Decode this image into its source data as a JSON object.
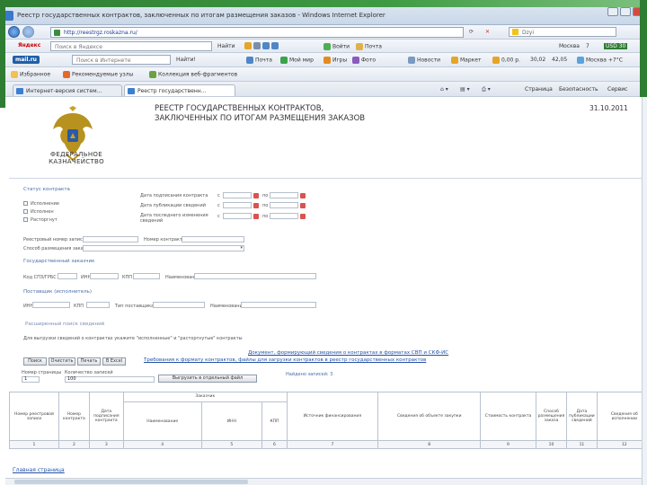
{
  "window": {
    "title": "Реестр государственных контрактов, заключенных по итогам размещения заказов - Windows Internet Explorer"
  },
  "toolbar1": {
    "url": "http://reestrgz.roskazna.ru/",
    "search_label": "Dzyi"
  },
  "toolbar2": {
    "yandex": "Яндекс",
    "search_placeholder": "Поиск в Яндексе",
    "find_label": "Найти",
    "login_label": "Войти",
    "mail_label": "Почта",
    "city": "Москва",
    "temp": "7",
    "usd": "USD 30"
  },
  "toolbar3": {
    "mailru": "mail.ru",
    "search_placeholder": "Поиск в Интернете",
    "find_label": "Найти!",
    "mail_label": "Почта",
    "my_world": "Мой мир",
    "games": "Игры",
    "photos": "Фото",
    "news": "Новости",
    "agent": "Маркет",
    "price1": "0,00 р.",
    "rate1": "30,02",
    "rate2": "42,05",
    "city": "Москва",
    "weather": "+7°С",
    "last": "12"
  },
  "toolbar4": {
    "favorites": "Избранное",
    "rec_sites": "Рекомендуемые узлы",
    "web_slices": "Коллекция веб-фрагментов"
  },
  "tabs": [
    {
      "label": "Интернет-версия систем..."
    },
    {
      "label": "Реестр государственн..."
    }
  ],
  "toolbar5": {
    "page": "Страница",
    "safety": "Безопасность",
    "service": "Сервис"
  },
  "header": {
    "title1": "РЕЕСТР ГОСУДАРСТВЕННЫХ КОНТРАКТОВ,",
    "title2": "ЗАКЛЮЧЕННЫХ ПО ИТОГАМ РАЗМЕЩЕНИЯ ЗАКАЗОВ",
    "date": "31.10.2011",
    "agency1": "ФЕДЕРАЛЬНОЕ",
    "agency2": "КАЗНАЧЕЙСТВО"
  },
  "form": {
    "status_section": "Статус контракта",
    "status_options": [
      "Исполнение",
      "Исполнен",
      "Расторгнут"
    ],
    "date_labels": [
      "Дата подписания контракта",
      "Дата публикации сведений",
      "Дата последнего изменения сведений"
    ],
    "from": "с",
    "to": "по",
    "reg_number": "Реестровый номер записи",
    "contract_number": "Номер контракта",
    "method": "Способ размещения заказа",
    "customer_section": "Государственный заказчик",
    "customer_fields": [
      "Код СПЗ/ГРБС",
      "ИНН",
      "КПП",
      "Наименование"
    ],
    "supplier_section": "Поставщик (исполнитель)",
    "supplier_fields": [
      "ИНН",
      "КПП",
      "Тип поставщика",
      "Наименование"
    ],
    "extended_search": "Расширенный поиск сведений",
    "checkbox_note": "Для выгрузки сведений о контрактах укажите \"исполненные\" и \"расторгнутые\" контракты"
  },
  "links": {
    "link1": "Документ, формирующий сведения о контрактах в форматах СВП и СКФ-ИС",
    "link2": "Требования к формату контрактов, файлы для загрузки контрактов в реестр государственных контрактов"
  },
  "buttons": {
    "search": "Поиск",
    "clear": "Очистить",
    "print": "Печать",
    "export": "В Excel",
    "download": "Выгрузить в отдельный файл"
  },
  "export_labels": {
    "page_label": "Номер страницы",
    "page_value": "1",
    "records_label": "Количество записей",
    "records_value": "100",
    "records_found": "Найдено записей: 3"
  },
  "table": {
    "top_group": "Заказчик",
    "columns": [
      "Номер реестровой записи",
      "Номер контракта",
      "Дата подписания контракта",
      "Наименование",
      "ИНН",
      "КПП",
      "Источник финансирования",
      "Сведения об объекте закупки",
      "Стоимость контракта",
      "Способ размещения заказа",
      "Дата публикации сведений",
      "Сведения об исполнении"
    ],
    "numbers": [
      "1",
      "2",
      "3",
      "4",
      "5",
      "6",
      "7",
      "8",
      "9",
      "10",
      "11",
      "12"
    ]
  },
  "footer": {
    "link": "Главная страница"
  }
}
